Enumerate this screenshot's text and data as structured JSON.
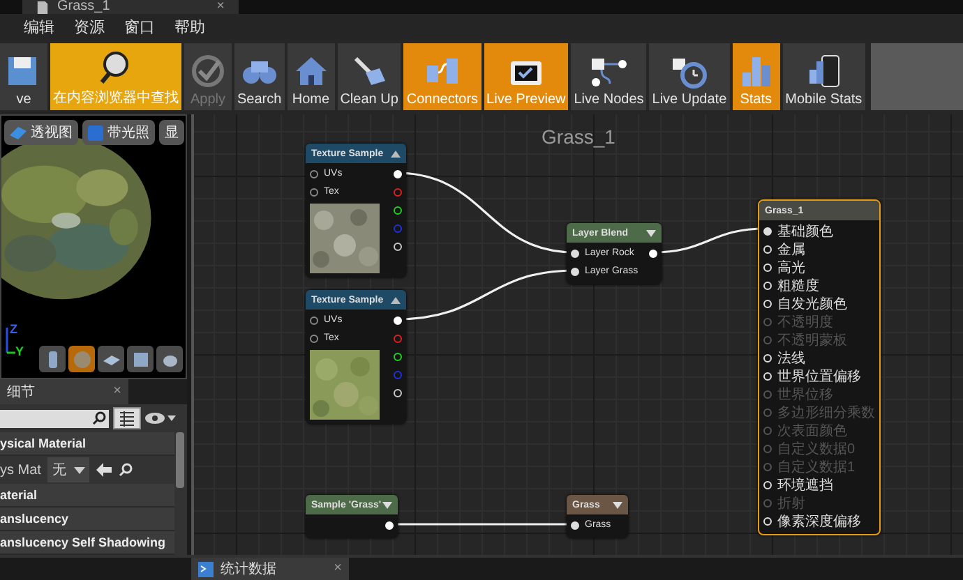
{
  "document_tab": {
    "title": "Grass_1",
    "close": "×"
  },
  "menu": [
    "编辑",
    "资源",
    "窗口",
    "帮助"
  ],
  "toolbar": [
    {
      "kind": "save",
      "label": "ve",
      "on": false,
      "disabled": false
    },
    {
      "kind": "find",
      "label": "在内容浏览器中查找",
      "on": true,
      "disabled": false
    },
    {
      "kind": "apply",
      "label": "Apply",
      "on": false,
      "disabled": true
    },
    {
      "kind": "search",
      "label": "Search",
      "on": false,
      "disabled": false
    },
    {
      "kind": "home",
      "label": "Home",
      "on": false,
      "disabled": false
    },
    {
      "kind": "cleanup",
      "label": "Clean Up",
      "on": false,
      "disabled": false
    },
    {
      "kind": "connectors",
      "label": "Connectors",
      "on": true,
      "disabled": false
    },
    {
      "kind": "live_preview",
      "label": "Live Preview",
      "on": true,
      "disabled": false
    },
    {
      "kind": "live_nodes",
      "label": "Live Nodes",
      "on": false,
      "disabled": false
    },
    {
      "kind": "live_update",
      "label": "Live Update",
      "on": false,
      "disabled": false
    },
    {
      "kind": "stats",
      "label": "Stats",
      "on": true,
      "disabled": false
    },
    {
      "kind": "mobile_stats",
      "label": "Mobile Stats",
      "on": false,
      "disabled": false
    }
  ],
  "viewport": {
    "buttons": [
      {
        "kind": "perspective",
        "label": "透视图"
      },
      {
        "kind": "lit",
        "label": "带光照"
      },
      {
        "kind": "show",
        "label": "显"
      }
    ],
    "axes": [
      "Z",
      "Y"
    ],
    "shape_buttons": [
      {
        "kind": "cylinder",
        "selected": false
      },
      {
        "kind": "sphere",
        "selected": true
      },
      {
        "kind": "plane",
        "selected": false
      },
      {
        "kind": "cube",
        "selected": false
      },
      {
        "kind": "teapot",
        "selected": false
      }
    ]
  },
  "details": {
    "tab": "细节",
    "close": "×",
    "rows": [
      {
        "kind": "header",
        "label": "ysical Material"
      },
      {
        "kind": "property",
        "label": "ys Mat",
        "value": "无"
      },
      {
        "kind": "header",
        "label": "aterial"
      },
      {
        "kind": "header",
        "label": "anslucency"
      },
      {
        "kind": "header",
        "label": "anslucency Self Shadowing"
      }
    ]
  },
  "graph": {
    "title": "Grass_1",
    "nodes": [
      {
        "kind": "texture",
        "title": "Texture Sample",
        "inputs": [
          {
            "label": "UVs",
            "connected": false
          },
          {
            "label": "Tex",
            "connected": false
          }
        ],
        "outputs": [
          {
            "color": "#ffffff",
            "connected": true
          },
          {
            "color": "#e02020",
            "connected": false
          },
          {
            "color": "#20d020",
            "connected": false
          },
          {
            "color": "#2030e0",
            "connected": false
          },
          {
            "color": "#c8c8c8",
            "connected": false
          }
        ]
      },
      {
        "kind": "texture",
        "title": "Texture Sample",
        "inputs": [
          {
            "label": "UVs",
            "connected": false
          },
          {
            "label": "Tex",
            "connected": false
          }
        ],
        "outputs": [
          {
            "color": "#ffffff",
            "connected": true
          },
          {
            "color": "#e02020",
            "connected": false
          },
          {
            "color": "#20d020",
            "connected": false
          },
          {
            "color": "#2030e0",
            "connected": false
          },
          {
            "color": "#c8c8c8",
            "connected": false
          }
        ]
      },
      {
        "kind": "function",
        "title": "Layer Blend",
        "inputs": [
          {
            "label": "Layer Rock",
            "connected": true
          },
          {
            "label": "Layer Grass",
            "connected": true
          }
        ],
        "outputs": [
          {
            "color": "#ffffff",
            "connected": true
          }
        ]
      },
      {
        "kind": "material",
        "title": "Grass_1",
        "inputs": [
          {
            "label": "基础颜色",
            "connected": true,
            "disabled": false
          },
          {
            "label": "金属",
            "connected": false,
            "disabled": false
          },
          {
            "label": "高光",
            "connected": false,
            "disabled": false
          },
          {
            "label": "粗糙度",
            "connected": false,
            "disabled": false
          },
          {
            "label": "自发光颜色",
            "connected": false,
            "disabled": false
          },
          {
            "label": "不透明度",
            "connected": false,
            "disabled": true
          },
          {
            "label": "不透明蒙板",
            "connected": false,
            "disabled": true
          },
          {
            "label": "法线",
            "connected": false,
            "disabled": false
          },
          {
            "label": "世界位置偏移",
            "connected": false,
            "disabled": false
          },
          {
            "label": "世界位移",
            "connected": false,
            "disabled": true
          },
          {
            "label": "多边形细分乘数",
            "connected": false,
            "disabled": true
          },
          {
            "label": "次表面颜色",
            "connected": false,
            "disabled": true
          },
          {
            "label": "自定义数据0",
            "connected": false,
            "disabled": true
          },
          {
            "label": "自定义数据1",
            "connected": false,
            "disabled": true
          },
          {
            "label": "环境遮挡",
            "connected": false,
            "disabled": false
          },
          {
            "label": "折射",
            "connected": false,
            "disabled": true
          },
          {
            "label": "像素深度偏移",
            "connected": false,
            "disabled": false
          }
        ]
      },
      {
        "kind": "function",
        "title": "Sample 'Grass'",
        "outputs": [
          {
            "color": "#ffffff",
            "connected": true
          }
        ]
      },
      {
        "kind": "reroute",
        "title": "Grass",
        "inputs": [
          {
            "label": "Grass",
            "connected": true
          }
        ]
      }
    ]
  },
  "bottom_tab": {
    "label": "统计数据",
    "close": "×"
  }
}
